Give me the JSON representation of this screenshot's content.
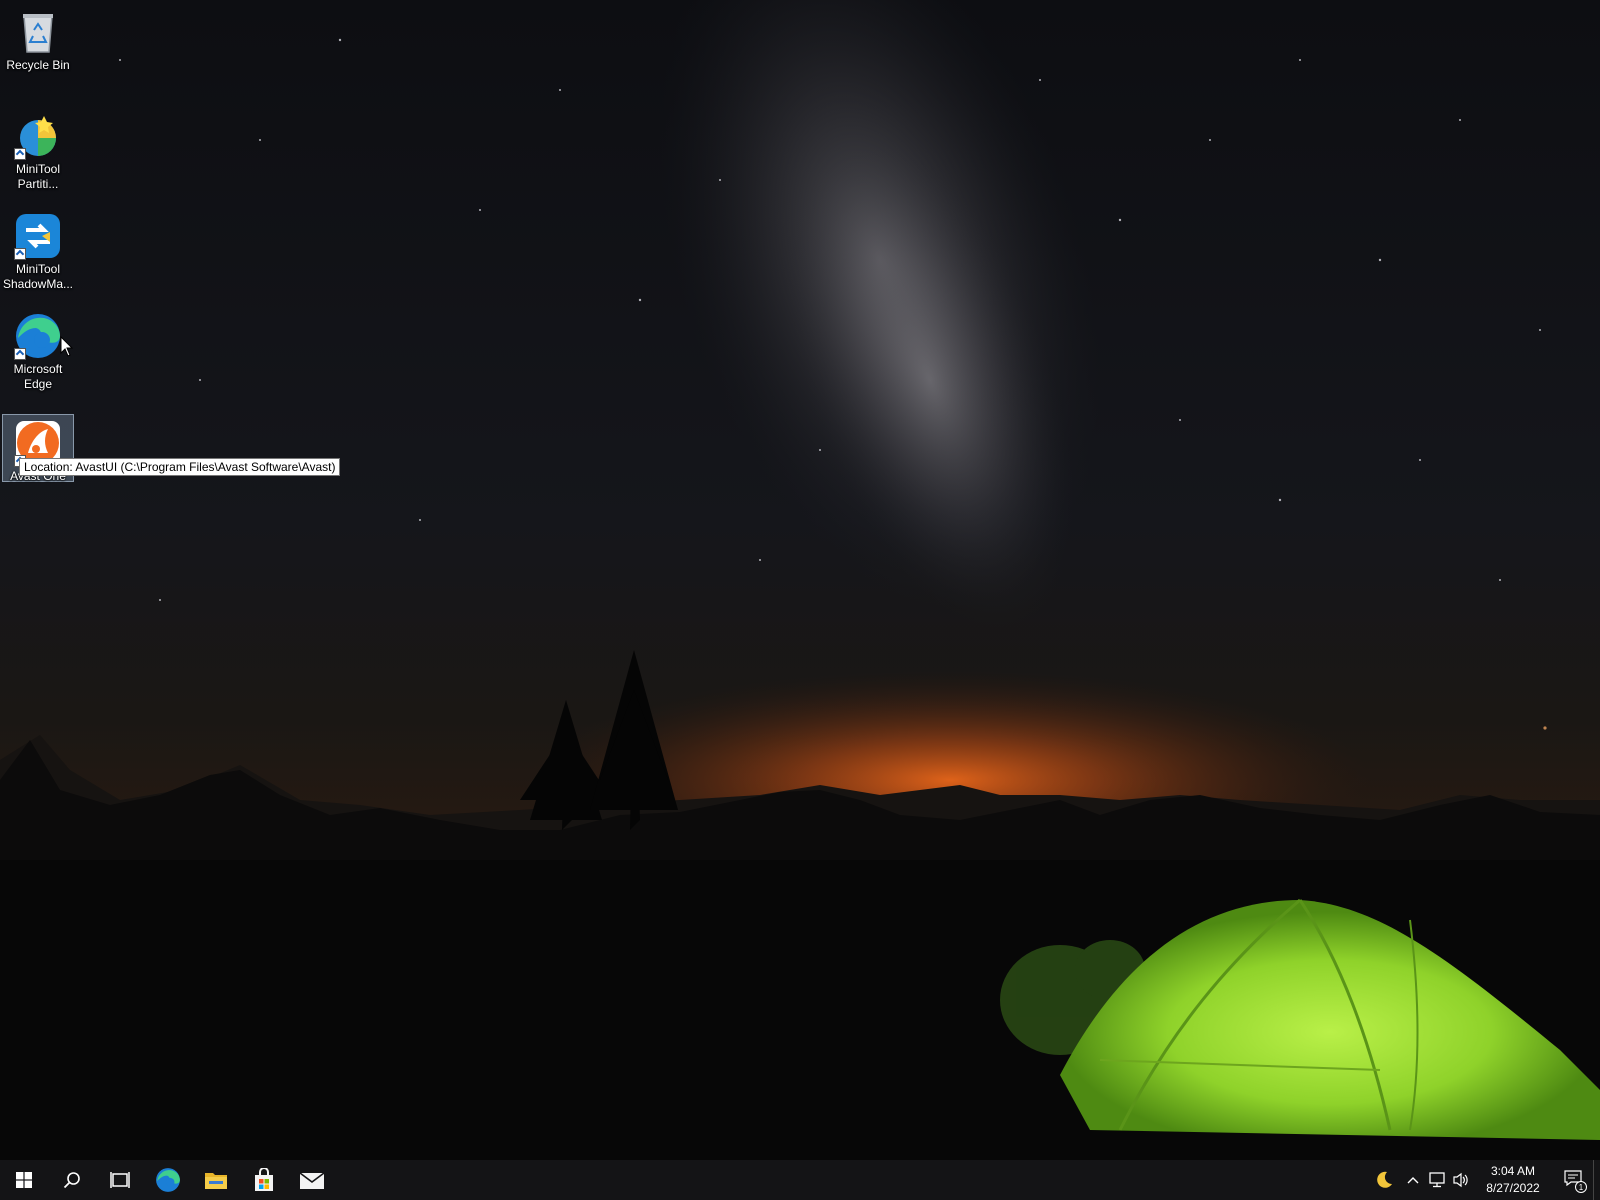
{
  "desktop": {
    "icons": [
      {
        "label": "Recycle Bin",
        "icon": "recycle-bin-icon"
      },
      {
        "label": "MiniTool\nPartiti...",
        "icon": "minitool-partition-icon"
      },
      {
        "label": "MiniTool\nShadowMa...",
        "icon": "minitool-shadowmaker-icon"
      },
      {
        "label": "Microsoft\nEdge",
        "icon": "edge-icon"
      },
      {
        "label": "Avast One",
        "icon": "avast-icon"
      }
    ],
    "tooltip": "Location: AvastUI (C:\\Program Files\\Avast Software\\Avast)"
  },
  "taskbar": {
    "buttons": [
      {
        "name": "start",
        "icon": "windows-logo-icon"
      },
      {
        "name": "search",
        "icon": "search-icon"
      },
      {
        "name": "task-view",
        "icon": "task-view-icon"
      },
      {
        "name": "edge",
        "icon": "edge-icon"
      },
      {
        "name": "file-explorer",
        "icon": "folder-icon"
      },
      {
        "name": "store",
        "icon": "store-bag-icon"
      },
      {
        "name": "mail",
        "icon": "mail-icon"
      }
    ],
    "tray": {
      "icons": [
        "moon-icon",
        "chevron-up-icon",
        "network-icon",
        "volume-icon"
      ],
      "time": "3:04 AM",
      "date": "8/27/2022",
      "notification_count": "1"
    }
  },
  "colors": {
    "taskbar_bg": "#141416",
    "tent_green": "#8fd22a",
    "horizon_orange": "#d8621a",
    "avast_orange": "#f26b21",
    "edge_blue": "#1b7fd6"
  }
}
